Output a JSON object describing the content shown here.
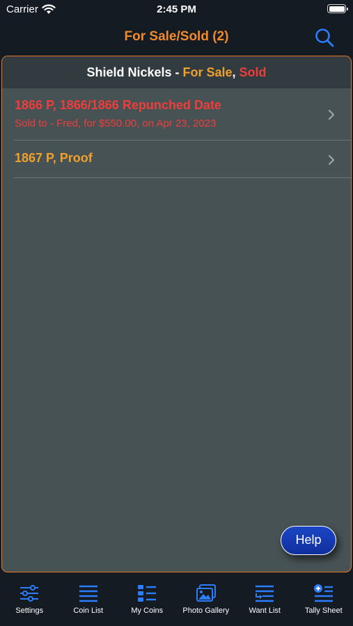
{
  "status_bar": {
    "carrier": "Carrier",
    "time": "2:45 PM"
  },
  "nav": {
    "title": "For Sale/Sold (2)",
    "search_icon": "search-icon"
  },
  "panel": {
    "header": {
      "prefix": "Shield Nickels - ",
      "for_sale": "For Sale",
      "separator": ", ",
      "sold": "Sold"
    },
    "items": [
      {
        "title": "1866 P, 1866/1866 Repunched Date",
        "subtitle": "Sold to - Fred, for $550.00, on Apr 23, 2023",
        "status": "sold"
      },
      {
        "title": "1867 P, Proof",
        "subtitle": "",
        "status": "for-sale"
      }
    ],
    "help_label": "Help"
  },
  "tabs": [
    {
      "label": "Settings",
      "icon": "sliders-icon"
    },
    {
      "label": "Coin List",
      "icon": "list-icon"
    },
    {
      "label": "My Coins",
      "icon": "grid-list-icon"
    },
    {
      "label": "Photo Gallery",
      "icon": "photos-icon"
    },
    {
      "label": "Want List",
      "icon": "want-list-icon"
    },
    {
      "label": "Tally Sheet",
      "icon": "tally-sheet-icon"
    }
  ],
  "colors": {
    "background": "#141b23",
    "panel": "#475254",
    "panel_header": "#323b40",
    "accent_orange": "#f08a2c",
    "for_sale": "#f0a02c",
    "sold": "#ef3d3a",
    "tab_icon_blue": "#2c7dff",
    "help_button": "#1c46c6"
  }
}
